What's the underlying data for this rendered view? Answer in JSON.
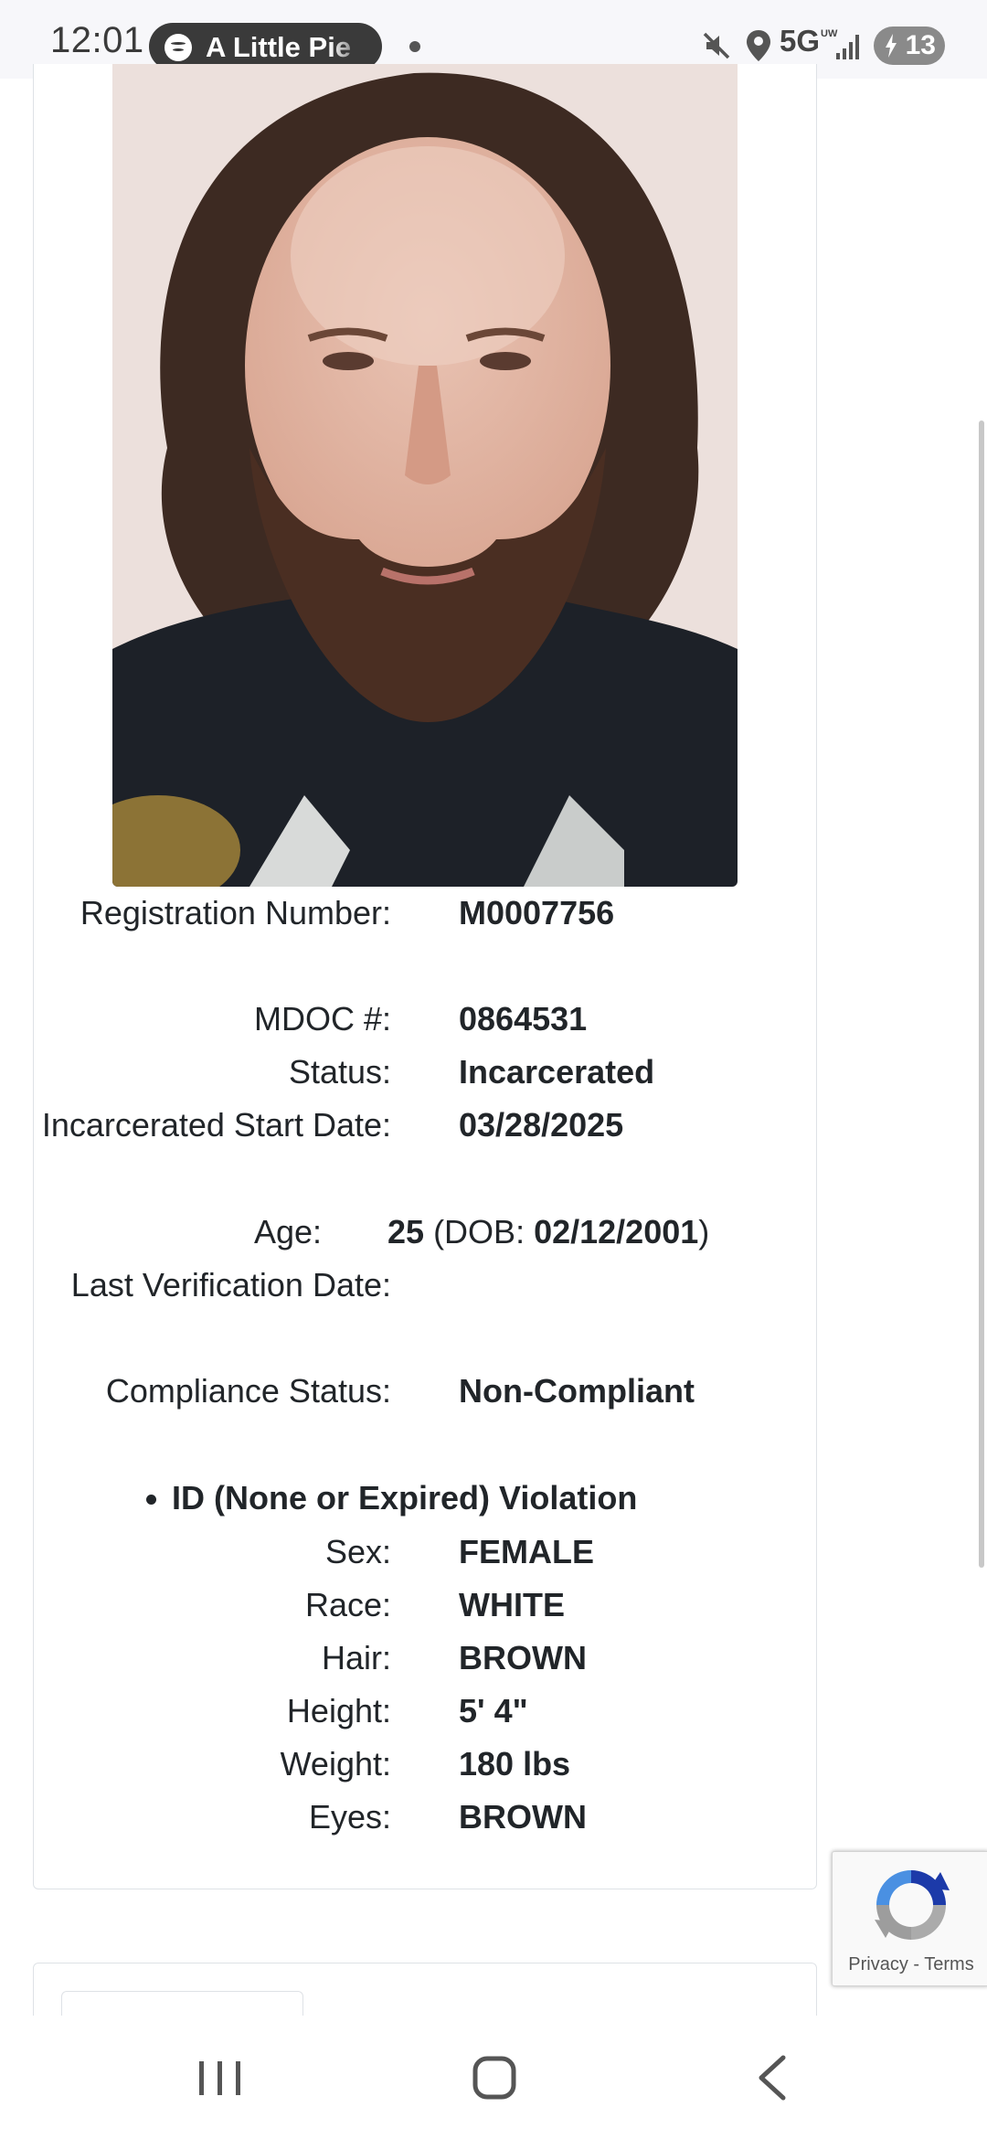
{
  "status_bar": {
    "time": "12:01",
    "media_title": "A Little Pie",
    "network": "5G",
    "network_sub": "UW",
    "battery": "13"
  },
  "profile": {
    "registration_label": "Registration Number:",
    "registration_value": "M0007756",
    "mdoc_label": "MDOC #:",
    "mdoc_value": "0864531",
    "status_label": "Status:",
    "status_value": "Incarcerated",
    "incarcerated_label": "Incarcerated Start Date:",
    "incarcerated_value": "03/28/2025",
    "age_label": "Age:",
    "age_value": "25",
    "dob_prefix": "(DOB: ",
    "dob_value": "02/12/2001",
    "dob_suffix": ")",
    "last_verification_label": "Last Verification Date:",
    "last_verification_value": "",
    "compliance_label": "Compliance Status:",
    "compliance_value": "Non-Compliant",
    "violation": "ID (None or Expired) Violation",
    "sex_label": "Sex:",
    "sex_value": "FEMALE",
    "race_label": "Race:",
    "race_value": "WHITE",
    "hair_label": "Hair:",
    "hair_value": "BROWN",
    "height_label": "Height:",
    "height_value": "5' 4\"",
    "weight_label": "Weight:",
    "weight_value": "180 lbs",
    "eyes_label": "Eyes:",
    "eyes_value": "BROWN"
  },
  "recaptcha": {
    "privacy": "Privacy",
    "separator": " - ",
    "terms": "Terms"
  },
  "icons": {
    "mute": "mute-icon",
    "location": "location-icon",
    "signal": "signal-icon",
    "spotify": "spotify-icon"
  }
}
